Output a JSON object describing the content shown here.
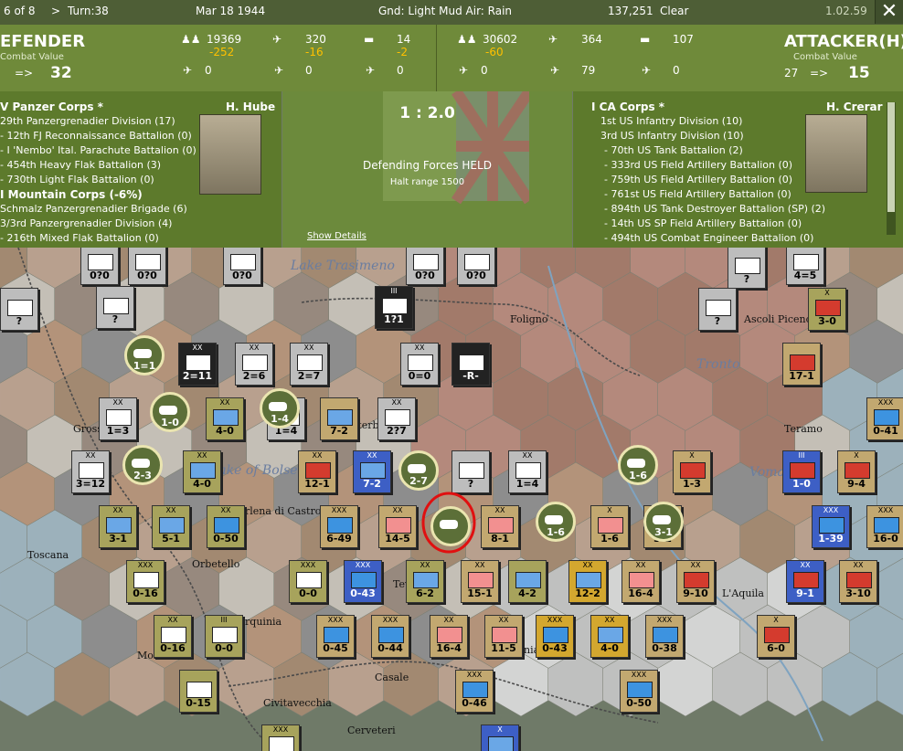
{
  "topbar": {
    "counter": "6 of 8",
    "arrow": ">",
    "turn": "Turn:38",
    "date": "Mar 18 1944",
    "ground": "Gnd: Light Mud  Air: Rain",
    "points": "137,251",
    "weather": "Clear",
    "version": "1.02.59",
    "close": "✕"
  },
  "defender": {
    "title": "EFENDER",
    "subtitle": "Combat Value",
    "arrow": "=>",
    "value": "32",
    "stats": {
      "men": "19369",
      "men_loss": "-252",
      "air": "320",
      "air_loss": "-16",
      "tank": "14",
      "tank_loss": "-2",
      "r2a": "0",
      "r2b": "0",
      "r2c": "0"
    }
  },
  "attacker": {
    "title": "ATTACKER(H)",
    "subtitle": "Combat Value",
    "base": "27",
    "arrow": "=>",
    "value": "15",
    "stats": {
      "men": "30602",
      "men_loss": "-60",
      "air": "364",
      "tank": "107",
      "r2a": "0",
      "r2b": "79",
      "r2c": "0"
    }
  },
  "left_panel": {
    "corps": "V Panzer Corps *",
    "commander": "H. Hube",
    "lines": [
      "29th Panzergrenadier Division (17)",
      "- 12th FJ Reconnaissance Battalion (0)",
      "- I 'Nembo' Ital. Parachute Battalion (0)",
      "- 454th Heavy Flak Battalion (3)",
      "- 730th Light Flak Battalion (0)",
      "I Mountain Corps (-6%)",
      "Schmalz Panzergrenadier Brigade (6)",
      "3/3rd Panzergrenadier Division (4)",
      "- 216th Mixed Flak Battalion (0)"
    ]
  },
  "center_panel": {
    "odds": "1 : 2.0",
    "result": "Defending Forces HELD",
    "halt": "Halt range 1500",
    "details": "Show Details"
  },
  "right_panel": {
    "corps": "I CA Corps *",
    "commander": "H. Crerar",
    "lines": [
      "1st US Infantry Division (10)",
      "3rd US Infantry Division (10)",
      "- 70th US Tank Battalion (2)",
      "- 333rd US Field Artillery Battalion (0)",
      "- 759th US Field Artillery Battalion (0)",
      "- 761st US Field Artillery Battalion (0)",
      "- 894th US Tank Destroyer Battalion (SP) (2)",
      "- 14th US SP Field Artillery Battalion (0)",
      "- 494th US Combat Engineer Battalion (0)"
    ]
  },
  "map": {
    "cities": [
      "Lake Trasimeno",
      "Foligno",
      "Ascoli Piceno",
      "Teramo",
      "Grosseto",
      "Lake of Bolsena",
      "Orbetello",
      "Arlena di Castro",
      "Tarquinia",
      "Civitavecchia",
      "Casale",
      "Guidonia",
      "L'Aquila",
      "Viterbo",
      "Terni",
      "Tevere",
      "Montalto",
      "Cerveteri",
      "Toscana",
      "Vomano",
      "Tronto"
    ],
    "units": [
      {
        "c": "gray",
        "t": "white",
        "s": "",
        "l": "0?0"
      },
      {
        "c": "gray",
        "t": "white",
        "s": "",
        "l": "0?0"
      },
      {
        "c": "gray",
        "t": "white",
        "s": "",
        "l": "0?0"
      },
      {
        "c": "gray",
        "t": "white",
        "s": "",
        "l": "0?0"
      },
      {
        "c": "gray",
        "t": "white",
        "s": "",
        "l": "0?0"
      },
      {
        "c": "gray",
        "t": "white",
        "s": "",
        "l": "?"
      },
      {
        "c": "gray",
        "t": "white",
        "s": "",
        "l": "4=5"
      },
      {
        "c": "gray",
        "t": "white",
        "s": "",
        "l": "?"
      },
      {
        "c": "gray",
        "t": "white",
        "s": "",
        "l": "?"
      },
      {
        "c": "black",
        "t": "white",
        "s": "III",
        "l": "1?1"
      },
      {
        "c": "gray",
        "t": "white",
        "s": "",
        "l": "?"
      },
      {
        "c": "khaki",
        "t": "red",
        "s": "X",
        "l": "3-0"
      },
      {
        "c": "black",
        "t": "white",
        "s": "XX",
        "l": "2=11"
      },
      {
        "c": "gray",
        "t": "white",
        "s": "XX",
        "l": "2=6"
      },
      {
        "c": "gray",
        "t": "white",
        "s": "XX",
        "l": "2=7"
      },
      {
        "c": "gray",
        "t": "white",
        "s": "XX",
        "l": "0=0"
      },
      {
        "c": "black",
        "t": "white",
        "s": "",
        "l": "-R-"
      },
      {
        "c": "tan",
        "t": "red",
        "s": "",
        "l": "17-1"
      },
      {
        "c": "gray",
        "t": "white",
        "s": "XX",
        "l": "1=3"
      },
      {
        "c": "khaki",
        "t": "lb",
        "s": "XX",
        "l": "4-0"
      },
      {
        "c": "gray",
        "t": "white",
        "s": "",
        "l": "1=4"
      },
      {
        "c": "tan",
        "t": "lb",
        "s": "",
        "l": "7-2"
      },
      {
        "c": "gray",
        "t": "white",
        "s": "XX",
        "l": "2?7"
      },
      {
        "c": "tan",
        "t": "hq",
        "s": "XXX",
        "l": "0-41"
      },
      {
        "c": "gray",
        "t": "white",
        "s": "XX",
        "l": "3=12"
      },
      {
        "c": "khaki",
        "t": "lb",
        "s": "XX",
        "l": "4-0"
      },
      {
        "c": "tan",
        "t": "red",
        "s": "XX",
        "l": "12-1"
      },
      {
        "c": "blue",
        "t": "lb",
        "s": "XX",
        "l": "7-2"
      },
      {
        "c": "gray",
        "t": "white",
        "s": "",
        "l": "?"
      },
      {
        "c": "gray",
        "t": "white",
        "s": "XX",
        "l": "1=4"
      },
      {
        "c": "tan",
        "t": "red",
        "s": "X",
        "l": "1-3"
      },
      {
        "c": "blue",
        "t": "red",
        "s": "III",
        "l": "1-0"
      },
      {
        "c": "tan",
        "t": "red",
        "s": "X",
        "l": "9-4"
      },
      {
        "c": "khaki",
        "t": "lb",
        "s": "XX",
        "l": "3-1"
      },
      {
        "c": "khaki",
        "t": "lb",
        "s": "XX",
        "l": "5-1"
      },
      {
        "c": "khaki",
        "t": "hq",
        "s": "XX",
        "l": "0-50"
      },
      {
        "c": "tan",
        "t": "hq",
        "s": "XXX",
        "l": "6-49"
      },
      {
        "c": "tan",
        "t": "pink",
        "s": "XX",
        "l": "14-5"
      },
      {
        "c": "tan",
        "t": "pink",
        "s": "XX",
        "l": "8-1"
      },
      {
        "c": "tan",
        "t": "pink",
        "s": "X",
        "l": "1-6"
      },
      {
        "c": "tan",
        "t": "red",
        "s": "X",
        "l": "3-1"
      },
      {
        "c": "blue",
        "t": "hq",
        "s": "XXX",
        "l": "1-39"
      },
      {
        "c": "tan",
        "t": "hq",
        "s": "XXX",
        "l": "16-0"
      },
      {
        "c": "khaki",
        "t": "white",
        "s": "XXX",
        "l": "0-16"
      },
      {
        "c": "khaki",
        "t": "white",
        "s": "XXX",
        "l": "0-0"
      },
      {
        "c": "blue",
        "t": "hq",
        "s": "XXX",
        "l": "0-43"
      },
      {
        "c": "khaki",
        "t": "lb",
        "s": "XX",
        "l": "6-2"
      },
      {
        "c": "tan",
        "t": "pink",
        "s": "XX",
        "l": "15-1"
      },
      {
        "c": "khaki",
        "t": "lb",
        "s": "",
        "l": "4-2"
      },
      {
        "c": "gold",
        "t": "lb",
        "s": "XX",
        "l": "12-2"
      },
      {
        "c": "tan",
        "t": "pink",
        "s": "XX",
        "l": "16-4"
      },
      {
        "c": "tan",
        "t": "red",
        "s": "XX",
        "l": "9-10"
      },
      {
        "c": "blue",
        "t": "red",
        "s": "XX",
        "l": "9-1"
      },
      {
        "c": "tan",
        "t": "red",
        "s": "XX",
        "l": "3-10"
      },
      {
        "c": "khaki",
        "t": "white",
        "s": "XX",
        "l": "0-16"
      },
      {
        "c": "khaki",
        "t": "white",
        "s": "III",
        "l": "0-0"
      },
      {
        "c": "tan",
        "t": "hq",
        "s": "XXX",
        "l": "0-45"
      },
      {
        "c": "tan",
        "t": "hq",
        "s": "XXX",
        "l": "0-44"
      },
      {
        "c": "tan",
        "t": "pink",
        "s": "XX",
        "l": "16-4"
      },
      {
        "c": "tan",
        "t": "pink",
        "s": "XX",
        "l": "11-5"
      },
      {
        "c": "gold",
        "t": "hq",
        "s": "XXX",
        "l": "0-43"
      },
      {
        "c": "gold",
        "t": "lb",
        "s": "XX",
        "l": "4-0"
      },
      {
        "c": "tan",
        "t": "hq",
        "s": "XXX",
        "l": "0-38"
      },
      {
        "c": "tan",
        "t": "red",
        "s": "X",
        "l": "6-0"
      },
      {
        "c": "khaki",
        "t": "white",
        "s": "",
        "l": "0-15"
      },
      {
        "c": "tan",
        "t": "hq",
        "s": "XXX",
        "l": "0-46"
      },
      {
        "c": "tan",
        "t": "hq",
        "s": "XXX",
        "l": "0-50"
      },
      {
        "c": "khaki",
        "t": "white",
        "s": "XXX",
        "l": ""
      },
      {
        "c": "blue",
        "t": "lb",
        "s": "X",
        "l": ""
      }
    ],
    "circle_labels": [
      "1=1",
      "1-0",
      "1-4",
      "2-3",
      "2-7",
      "1-6",
      "1-6",
      "3-1"
    ]
  },
  "colors": {
    "topbar": "#4e5e36",
    "statbar": "#6f8a3a",
    "panel": "#5d7a2c",
    "loss": "#ffc000",
    "highlight": "#e01010"
  }
}
